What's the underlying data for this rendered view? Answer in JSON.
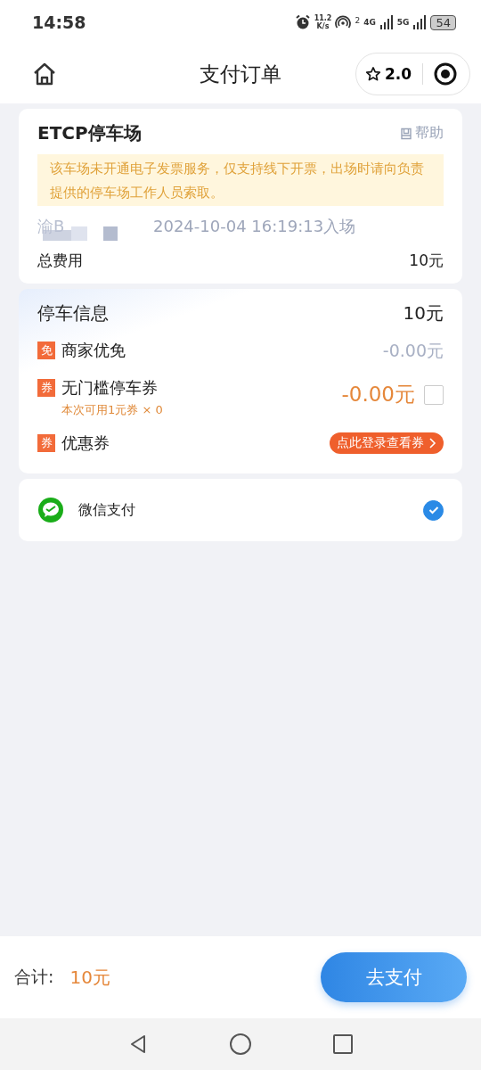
{
  "status_bar": {
    "time": "14:58",
    "speed": "11.2",
    "speed_unit": "K/s",
    "sim": "2",
    "net_1": "4G",
    "net_2": "5G",
    "battery": "54"
  },
  "header": {
    "title": "支付订单",
    "rating": "2.0"
  },
  "lot": {
    "name": "ETCP停车场",
    "help": "帮助",
    "notice": "该车场未开通电子发票服务，仅支持线下开票，出场时请向负责提供的停车场工作人员索取。",
    "plate": "渝B",
    "entry": "2024-10-04 16:19:13入场",
    "total_label": "总费用",
    "total": "10元"
  },
  "parking": {
    "title": "停车信息",
    "amount": "10元",
    "rows": [
      {
        "kind": "plain",
        "tag": "免",
        "label": "商家优免",
        "amount": "-0.00元"
      },
      {
        "kind": "checkbox",
        "tag": "券",
        "label": "无门槛停车券",
        "note": "本次可用1元券 × 0",
        "amount": "-0.00元",
        "checked": false
      },
      {
        "kind": "link",
        "tag": "券",
        "label": "优惠券",
        "link": "点此登录查看券"
      }
    ]
  },
  "payment": {
    "label": "微信支付",
    "checked": true
  },
  "footer": {
    "total_label": "合计:",
    "total": "10元",
    "pay": "去支付"
  }
}
